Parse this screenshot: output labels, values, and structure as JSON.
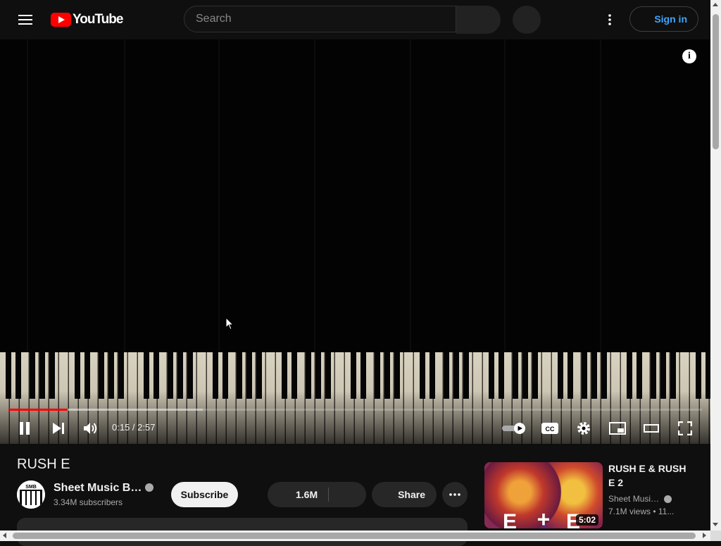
{
  "header": {
    "logo_text": "YouTube",
    "search_placeholder": "Search",
    "signin_label": "Sign in"
  },
  "player": {
    "current_time": "0:15",
    "duration": "2:57",
    "time_text": "0:15 / 2:57",
    "played_fraction": 0.085,
    "buffered_fraction": 0.28,
    "volume_fraction": 1.0
  },
  "video": {
    "title": "RUSH E",
    "channel_name": "Sheet Music Bo...",
    "subscribers": "3.34M subscribers",
    "subscribe_label": "Subscribe",
    "likes": "1.6M",
    "share_label": "Share"
  },
  "recommendation": {
    "title": "RUSH E & RUSH E 2",
    "channel": "Sheet Music...",
    "meta": "7.1M views • 11...",
    "duration": "5:02"
  },
  "colors": {
    "background": "#0f0f0f",
    "brand_red": "#ff0000",
    "link_blue": "#3ea6ff",
    "progress_red": "#ff0000"
  },
  "icons": [
    "menu-icon",
    "youtube-logo",
    "search-icon",
    "mic-icon",
    "more-vert-icon",
    "user-icon",
    "info-icon",
    "pause-icon",
    "next-icon",
    "volume-icon",
    "autoplay-toggle",
    "captions-icon",
    "settings-icon",
    "miniplayer-icon",
    "theater-icon",
    "fullscreen-icon",
    "verified-icon",
    "like-icon",
    "dislike-icon",
    "share-icon",
    "more-horiz-icon"
  ]
}
